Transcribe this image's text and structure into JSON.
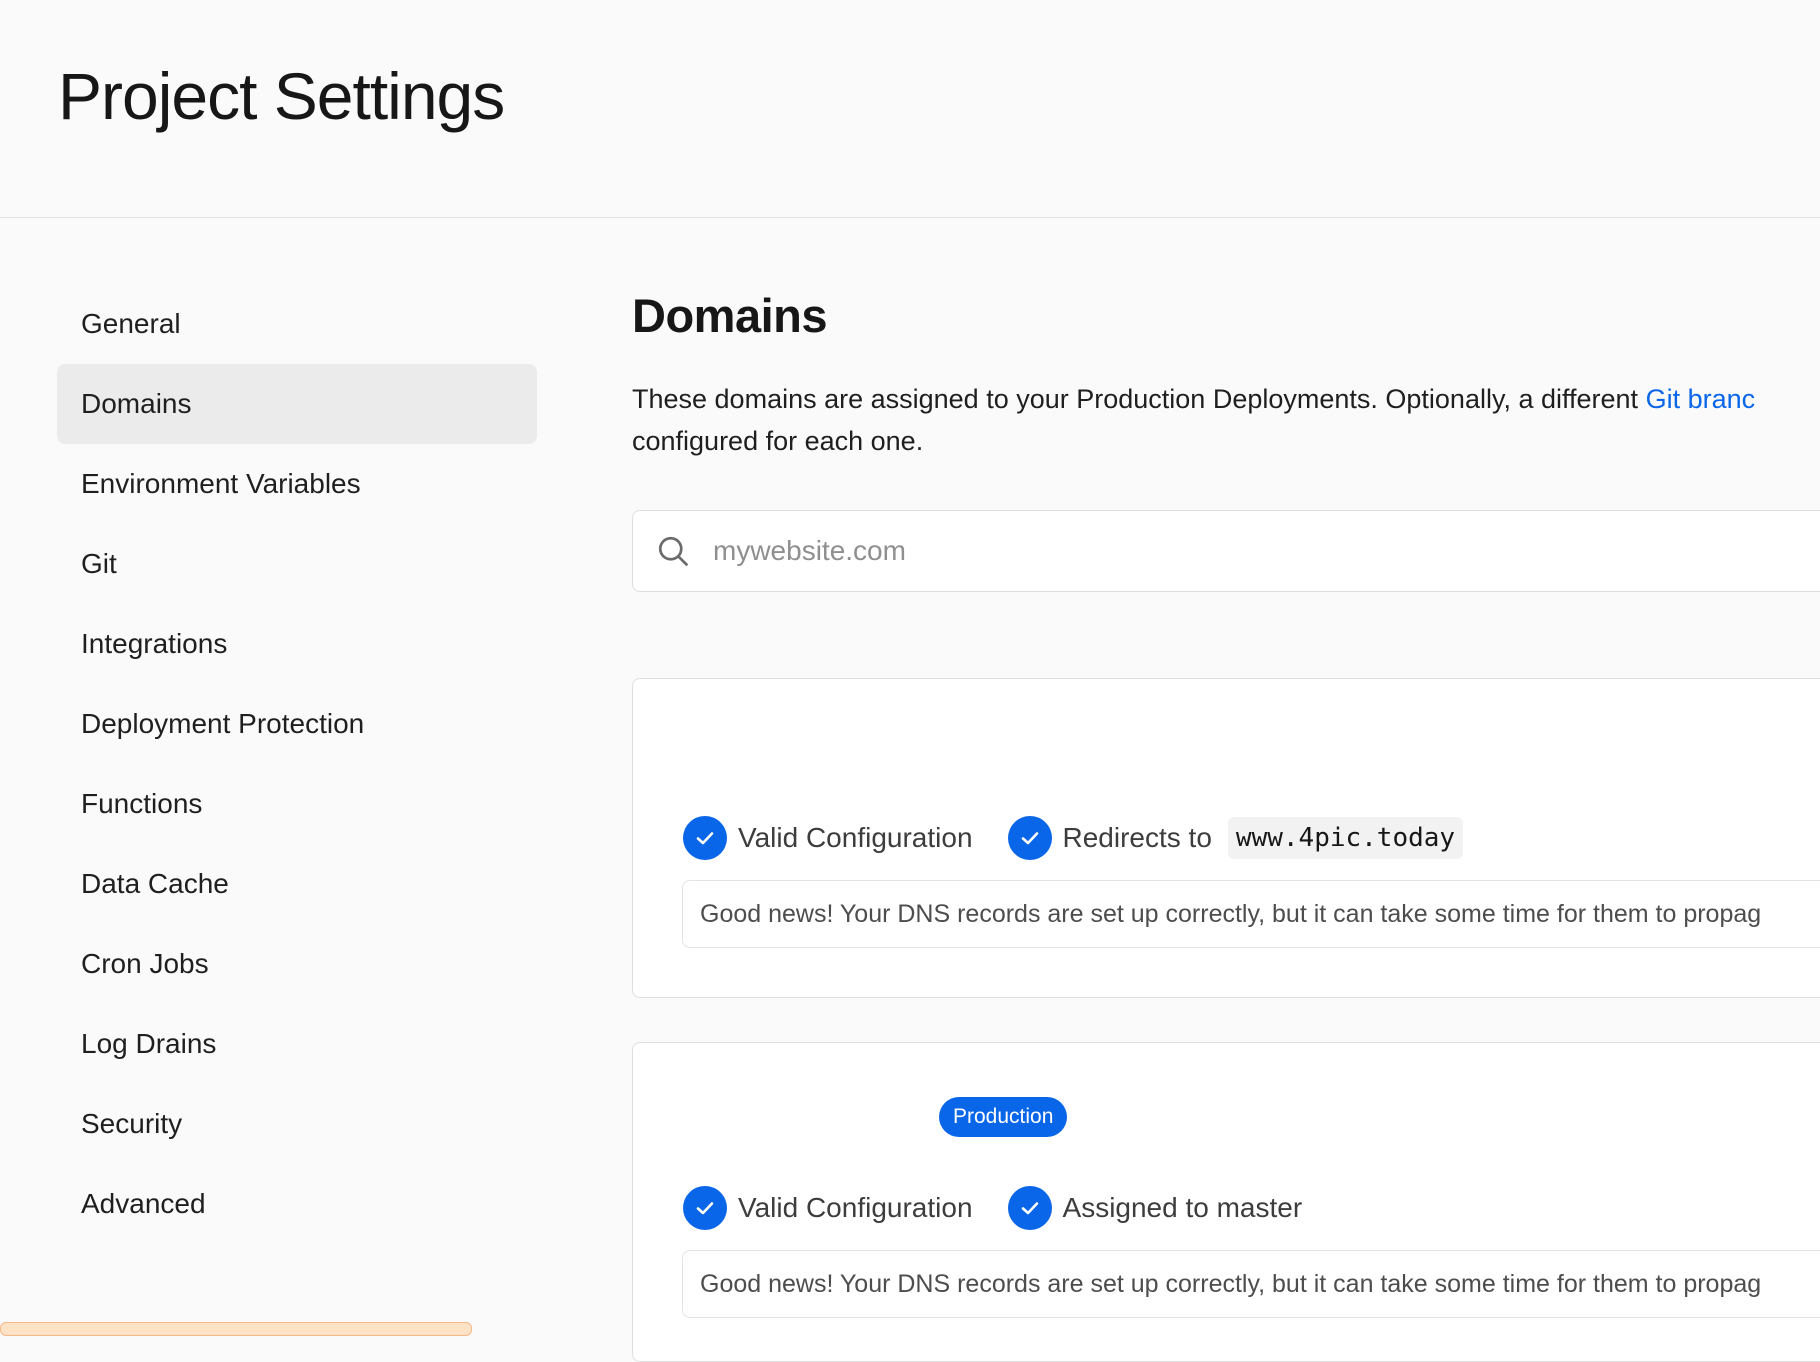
{
  "header": {
    "title": "Project Settings"
  },
  "sidebar": {
    "items": [
      {
        "label": "General"
      },
      {
        "label": "Domains",
        "active": true
      },
      {
        "label": "Environment Variables"
      },
      {
        "label": "Git"
      },
      {
        "label": "Integrations"
      },
      {
        "label": "Deployment Protection"
      },
      {
        "label": "Functions"
      },
      {
        "label": "Data Cache"
      },
      {
        "label": "Cron Jobs"
      },
      {
        "label": "Log Drains"
      },
      {
        "label": "Security"
      },
      {
        "label": "Advanced"
      }
    ]
  },
  "domains": {
    "title": "Domains",
    "description_before_link": "These domains are assigned to your Production Deployments. Optionally, a different ",
    "description_link": "Git branc",
    "description_line2": "configured for each one.",
    "search_placeholder": "mywebsite.com",
    "search_icon": "search-icon",
    "cards": [
      {
        "status_1": "Valid Configuration",
        "status_2": "Redirects to",
        "redirect_target": "www.4pic.today",
        "notice": "Good news! Your DNS records are set up correctly, but it can take some time for them to propag"
      },
      {
        "badge": "Production",
        "status_1": "Valid Configuration",
        "status_2": "Assigned to master",
        "notice": "Good news! Your DNS records are set up correctly, but it can take some time for them to propag"
      }
    ]
  },
  "colors": {
    "accent": "#0a66e8",
    "background": "#fafafa",
    "active_item": "#ebebeb"
  }
}
